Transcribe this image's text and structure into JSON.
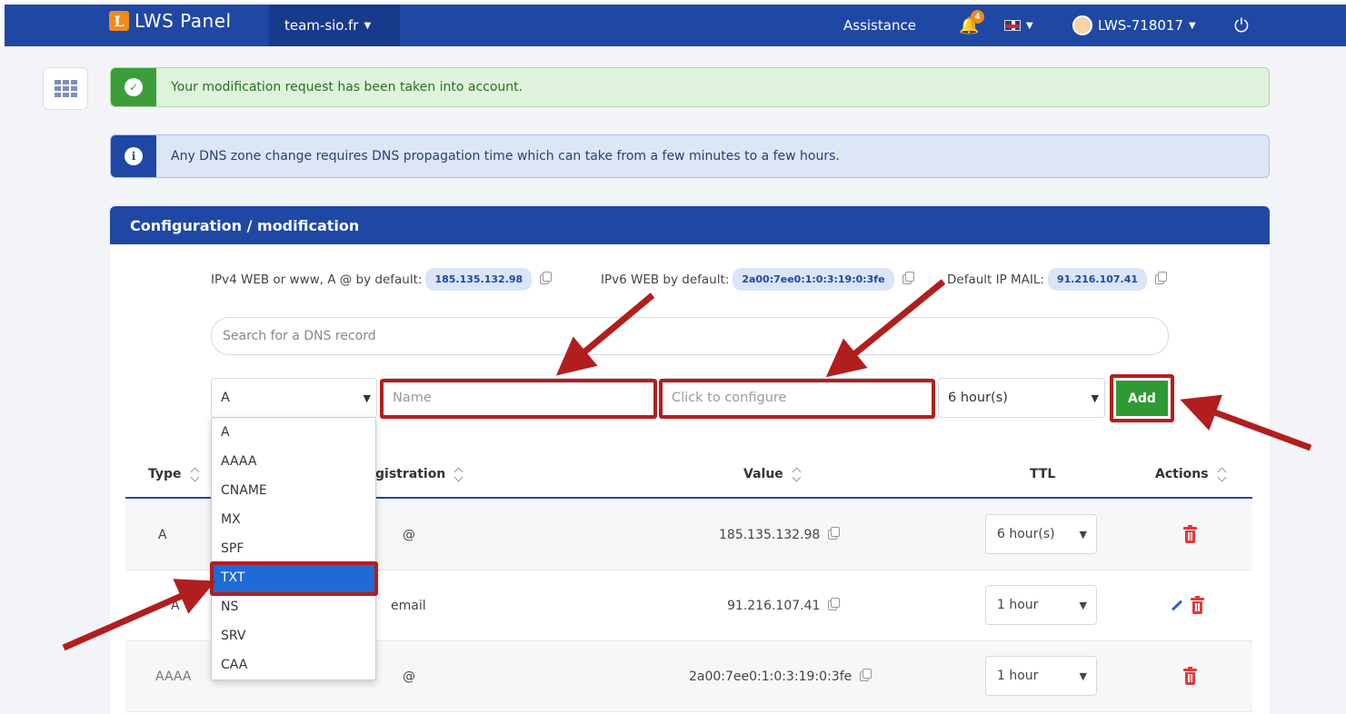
{
  "topbar": {
    "logo_mark": "L",
    "logo_text": "LWS Panel",
    "domain": "team-sio.fr",
    "assistance": "Assistance",
    "notifications_count": "4",
    "account": "LWS-718017"
  },
  "alerts": {
    "success": "Your modification request has been taken into account.",
    "info": "Any DNS zone change requires DNS propagation time which can take from a few minutes to a few hours."
  },
  "card": {
    "title": "Configuration / modification",
    "ipv4_label": "IPv4 WEB or www, A @ by default:",
    "ipv4_value": "185.135.132.98",
    "ipv6_label": "IPv6 WEB by default:",
    "ipv6_value": "2a00:7ee0:1:0:3:19:0:3fe",
    "mail_label": "Default IP MAIL:",
    "mail_value": "91.216.107.41",
    "search_placeholder": "Search for a DNS record"
  },
  "form": {
    "type_value": "A",
    "name_placeholder": "Name",
    "value_placeholder": "Click to configure",
    "ttl_value": "6 hour(s)",
    "add_label": "Add"
  },
  "type_options": [
    "A",
    "AAAA",
    "CNAME",
    "MX",
    "SPF",
    "TXT",
    "NS",
    "SRV",
    "CAA"
  ],
  "selected_option": "TXT",
  "table": {
    "headers": {
      "type": "Type",
      "registration": "gistration",
      "value": "Value",
      "ttl": "TTL",
      "actions": "Actions"
    },
    "rows": [
      {
        "type": "A",
        "registration": "@",
        "value": "185.135.132.98",
        "ttl": "6 hour(s)"
      },
      {
        "type": "A",
        "registration": "email",
        "value": "91.216.107.41",
        "ttl": "1 hour"
      },
      {
        "type": "AAAA",
        "registration": "@",
        "value": "2a00:7ee0:1:0:3:19:0:3fe",
        "ttl": "1 hour"
      }
    ]
  },
  "colors": {
    "brand_blue": "#1f48a4",
    "success_green": "#2f9a33",
    "highlight_red": "#b21e1e",
    "logo_orange": "#f08a1c"
  }
}
